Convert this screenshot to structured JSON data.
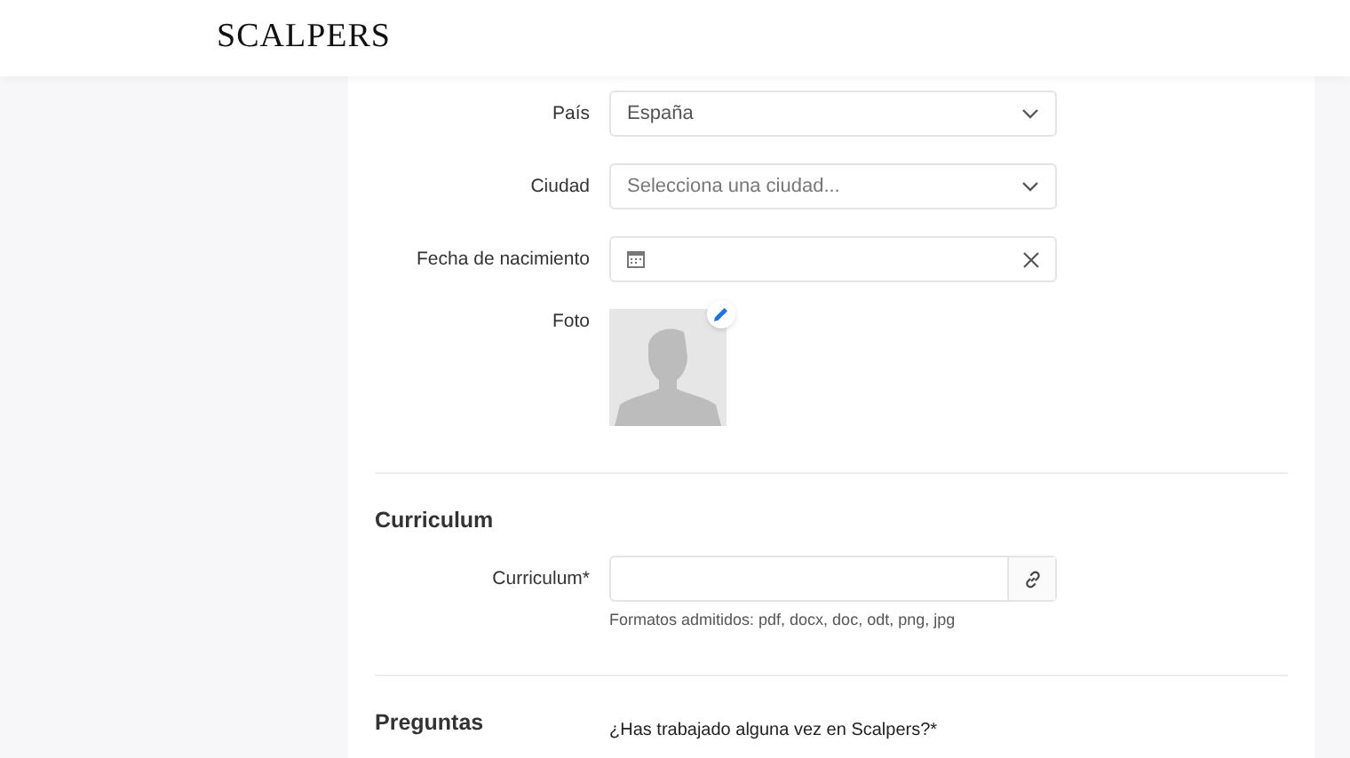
{
  "header": {
    "logo": "SCALPERS"
  },
  "fields": [
    {
      "kind": "select",
      "label": "País",
      "value": "España"
    },
    {
      "kind": "select",
      "label": "Ciudad",
      "placeholder": "Selecciona una ciudad..."
    },
    {
      "kind": "date",
      "label": "Fecha de nacimiento"
    },
    {
      "kind": "photo",
      "label": "Foto"
    }
  ],
  "sections": [
    {
      "title": "Curriculum",
      "fields": [
        {
          "kind": "file",
          "label": "Curriculum*",
          "hint": "Formatos admitidos: pdf, docx, doc, odt, png, jpg"
        }
      ]
    },
    {
      "title": "Preguntas",
      "fields": [
        {
          "kind": "question",
          "label": "¿Has trabajado alguna vez en Scalpers?*"
        }
      ]
    }
  ]
}
